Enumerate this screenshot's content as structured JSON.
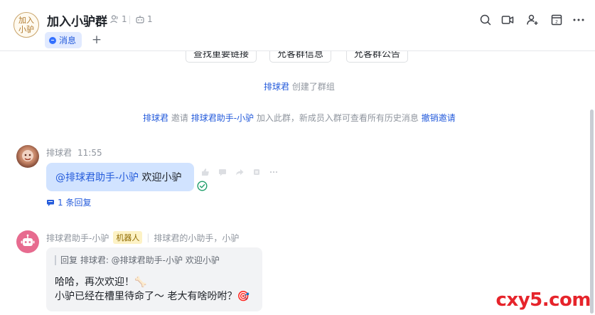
{
  "header": {
    "avatar_text": "加入\n小驴",
    "title": "加入小驴群",
    "member_count": "1",
    "bot_count": "1",
    "tab_messages": "消息",
    "add_tab": "+"
  },
  "chat": {
    "top_pills": [
      "查找重要链接",
      "允客群信息",
      "允客群公告"
    ],
    "system_created": {
      "actor": "排球君",
      "text": "创建了群组"
    },
    "system_invite": {
      "actor": "排球君",
      "verb": "邀请",
      "target": "排球君助手-小驴",
      "text": "加入此群，新成员入群可查看所有历史消息",
      "revoke": "撤销邀请"
    },
    "messages": [
      {
        "sender": "排球君",
        "time": "11:55",
        "mention": "@排球君助手-小驴",
        "text": "欢迎小驴",
        "replies": "1 条回复"
      },
      {
        "sender": "排球君助手-小驴",
        "badge": "机器人",
        "description": "排球君的小助手，小驴",
        "quote": "回复 排球君:  @排球君助手-小驴 欢迎小驴",
        "line1": "哈哈，再次欢迎！🦴",
        "line2": "小驴已经在槽里待命了～ 老大有啥吩咐？🎯"
      }
    ]
  },
  "watermark": "cxy5.com",
  "colors": {
    "link": "#245bdb",
    "bubble_self": "#d1e3ff",
    "bubble_other": "#f2f3f5",
    "accent": "#3370ff",
    "watermark": "#e6242b"
  }
}
